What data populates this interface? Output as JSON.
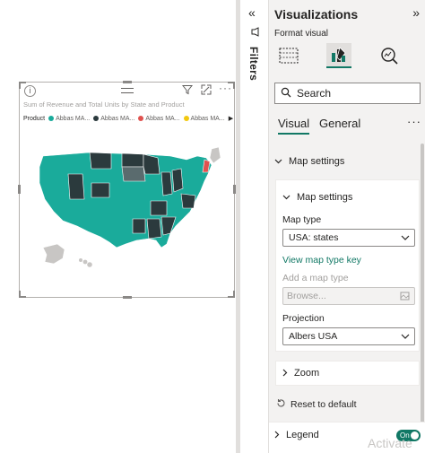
{
  "canvas": {
    "visual": {
      "title": "Sum of Revenue and Total Units by State and Product",
      "legend_label": "Product",
      "legend_items": [
        {
          "label": "Abbas MA...",
          "color": "#1aab9b"
        },
        {
          "label": "Abbas MA...",
          "color": "#2b3a3d"
        },
        {
          "label": "Abbas MA...",
          "color": "#e0524f"
        },
        {
          "label": "Abbas MA...",
          "color": "#f2c80f"
        }
      ],
      "legend_more": "▶",
      "map_colors": {
        "teal": "#1aab9b",
        "dark": "#2b3a3d",
        "mid": "#5a6b6e",
        "gray": "#c8c6c4",
        "red": "#e0524f"
      }
    }
  },
  "filters": {
    "collapse_icon": "«",
    "label": "Filters"
  },
  "pane": {
    "title": "Visualizations",
    "expand_icon": "»",
    "format_visual_label": "Format visual",
    "search_placeholder": "Search",
    "tabs": [
      {
        "label": "Visual"
      },
      {
        "label": "General"
      }
    ],
    "more": "···",
    "map_settings_outer": "Map settings",
    "map_settings_inner": "Map settings",
    "map_type_label": "Map type",
    "map_type_value": "USA: states",
    "view_map_type_key": "View map type key",
    "add_map_type_label": "Add a map type",
    "browse_placeholder": "Browse...",
    "projection_label": "Projection",
    "projection_value": "Albers USA",
    "zoom_label": "Zoom",
    "reset_label": "Reset to default",
    "legend_label": "Legend",
    "legend_toggle": "On",
    "accent": "#117865"
  },
  "watermark": "Activate"
}
